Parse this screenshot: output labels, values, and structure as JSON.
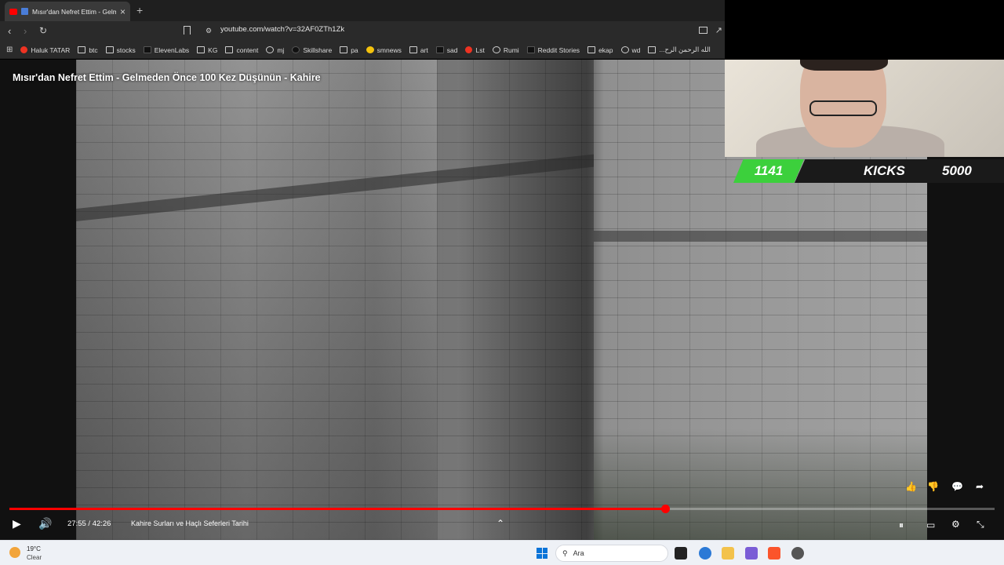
{
  "browser": {
    "tab_title": "Mısır'dan Nefret Ettim - Gelm",
    "new_tab_symbol": "+",
    "url": "youtube.com/watch?v=32AF0ZTh1Zk"
  },
  "bookmarks": [
    "Haluk TATAR",
    "btc",
    "stocks",
    "ElevenLabs",
    "KG",
    "content",
    "mj",
    "Skillshare",
    "pa",
    "smnews",
    "art",
    "sad",
    "Lst",
    "Rumi",
    "Reddit Stories",
    "ekap",
    "wd",
    "...الله الرحمن الرح"
  ],
  "video": {
    "title": "Mısır'dan Nefret Ettim - Gelmeden Önce 100 Kez Düşünün - Kahire",
    "time": "27:55 / 42:26",
    "chapter": "Kahire Surları ve Haçlı Seferleri Tarihi",
    "progress_fraction": 0.666
  },
  "overlay": {
    "count": "1141",
    "label": "KICKS",
    "goal": "5000"
  },
  "taskbar": {
    "temperature": "19°C",
    "condition": "Clear",
    "search_placeholder": "Ara"
  },
  "colors": {
    "accent": "#ff0000",
    "kicks_green": "#3cd03c"
  }
}
